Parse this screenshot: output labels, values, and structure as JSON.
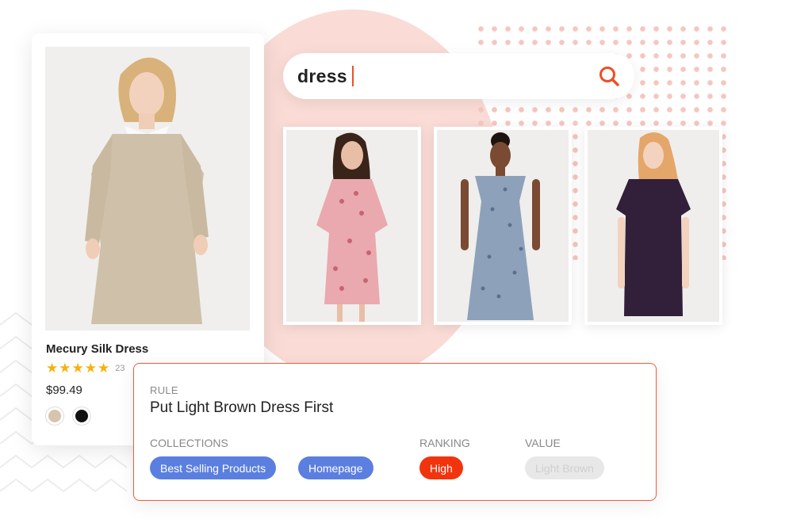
{
  "search": {
    "query": "dress",
    "icon": "search-icon"
  },
  "product": {
    "name": "Mecury Silk Dress",
    "rating": 5,
    "review_count": "23",
    "price": "$99.49",
    "swatch_colors": [
      "#d6c4ae",
      "#111111"
    ]
  },
  "results": [
    {
      "dress_color": "#e9a9ae",
      "pattern": "floral"
    },
    {
      "dress_color": "#8ea1bb",
      "pattern": "floral"
    },
    {
      "dress_color": "#32203a",
      "pattern": "solid"
    }
  ],
  "rule": {
    "section_label": "RULE",
    "title": "Put Light Brown Dress First",
    "collections_label": "COLLECTIONS",
    "collections": [
      "Best Selling Products",
      "Homepage"
    ],
    "ranking_label": "RANKING",
    "ranking_value": "High",
    "value_label": "VALUE",
    "value": "Light Brown"
  },
  "colors": {
    "accent": "#f04e23",
    "chip_blue": "#5b7fdf",
    "chip_red": "#f2340e",
    "star": "#f5b20f"
  }
}
